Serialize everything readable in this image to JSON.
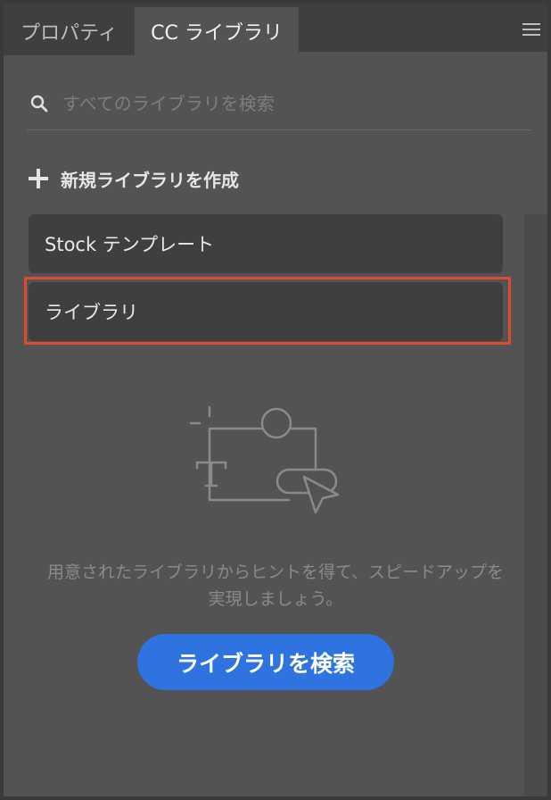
{
  "tabs": [
    {
      "label": "プロパティ",
      "active": false
    },
    {
      "label": "CC ライブラリ",
      "active": true
    }
  ],
  "menu_icon": "hamburger-menu-icon",
  "search": {
    "placeholder": "すべてのライブラリを検索",
    "value": "",
    "icon": "search-icon"
  },
  "new_library": {
    "icon": "plus-icon",
    "label": "新規ライブラリを作成"
  },
  "libraries": [
    {
      "label": "Stock テンプレート"
    },
    {
      "label": "ライブラリ",
      "highlighted": true
    }
  ],
  "empty_state": {
    "illustration": "library-assets-illustration",
    "hint": "用意されたライブラリからヒントを得て、スピードアップを実現しましょう。",
    "button_label": "ライブラリを検索"
  },
  "colors": {
    "panel_bg": "#535353",
    "item_bg": "#3f3f3f",
    "accent": "#2f73e0",
    "highlight": "#e04a2f"
  }
}
